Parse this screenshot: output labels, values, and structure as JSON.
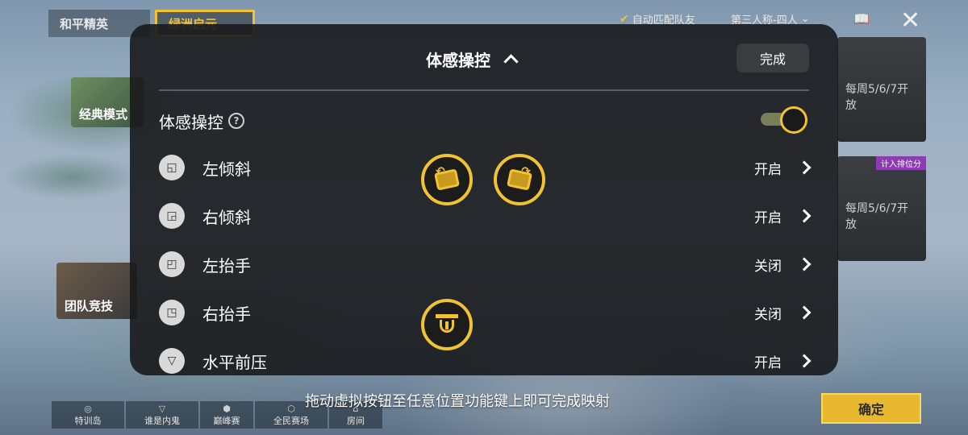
{
  "lobby": {
    "tabs": [
      "和平精英",
      "绿洲启元"
    ],
    "auto_match": "自动匹配队友",
    "view_mode": "第三人称-四人",
    "cards": {
      "classic": "经典模式",
      "team": "团队竞技",
      "right_top_open": "每周5/6/7开放",
      "right_bottom_open": "每周5/6/7开放",
      "rank_tag": "计入排位分"
    },
    "bottom_items": [
      "特训岛",
      "谁是内鬼",
      "巅峰赛",
      "全民赛场",
      "房间"
    ],
    "confirm_label": "确定"
  },
  "hint": "拖动虚拟按钮至任意位置功能键上即可完成映射",
  "panel": {
    "title": "体感操控",
    "done_label": "完成",
    "section_label": "体感操控",
    "help_glyph": "?",
    "toggle_on": true,
    "items": [
      {
        "label": "左倾斜",
        "status": "开启"
      },
      {
        "label": "右倾斜",
        "status": "开启"
      },
      {
        "label": "左抬手",
        "status": "关闭"
      },
      {
        "label": "右抬手",
        "status": "关闭"
      },
      {
        "label": "水平前压",
        "status": "开启"
      }
    ]
  },
  "colors": {
    "accent": "#f1c232",
    "panel_bg": "#181a1c",
    "confirm_bg": "#e8b82e"
  },
  "icons": {
    "close": "close-icon",
    "book": "book-icon",
    "check": "check-icon",
    "help": "help-icon",
    "chevron_up": "chevron-up-icon",
    "chevron_right": "chevron-right-icon"
  }
}
